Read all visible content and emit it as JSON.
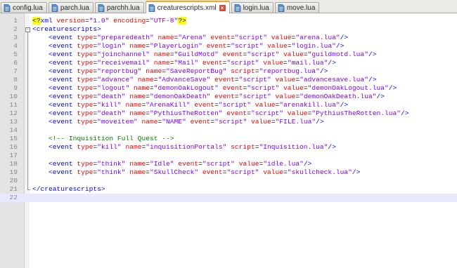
{
  "tabs": [
    {
      "label": "config.lua",
      "active": false
    },
    {
      "label": "parch.lua",
      "active": false
    },
    {
      "label": "parchh.lua",
      "active": false
    },
    {
      "label": "creaturescripts.xml",
      "active": true
    },
    {
      "label": "login.lua",
      "active": false
    },
    {
      "label": "move.lua",
      "active": false
    }
  ],
  "colors": {
    "tag": "#0000ff",
    "attribute": "#ff0000",
    "value": "#8000ff",
    "comment": "#008000",
    "line_number": "#878787",
    "current_line": "#e8e8ff",
    "active_tab_accent": "#f5a623"
  },
  "editor": {
    "current_line": 22,
    "lines": [
      {
        "n": "1",
        "tokens": [
          [
            "decl",
            "<?"
          ],
          [
            "tag",
            "xml "
          ],
          [
            "attr",
            "version"
          ],
          [
            "eq",
            "="
          ],
          [
            "val",
            "\"1.0\" "
          ],
          [
            "attr",
            "encoding"
          ],
          [
            "eq",
            "="
          ],
          [
            "val",
            "\"UTF-8\""
          ],
          [
            "decl",
            "?>"
          ]
        ]
      },
      {
        "n": "2",
        "tokens": [
          [
            "tag",
            "<creaturescripts>"
          ]
        ]
      },
      {
        "n": "3",
        "tokens": [
          [
            "tag",
            "    <event "
          ],
          [
            "attr",
            "type"
          ],
          [
            "eq",
            "="
          ],
          [
            "val",
            "\"preparedeath\" "
          ],
          [
            "attr",
            "name"
          ],
          [
            "eq",
            "="
          ],
          [
            "val",
            "\"Arena\" "
          ],
          [
            "attr",
            "event"
          ],
          [
            "eq",
            "="
          ],
          [
            "val",
            "\"script\" "
          ],
          [
            "attr",
            "value"
          ],
          [
            "eq",
            "="
          ],
          [
            "val",
            "\"arena.lua\""
          ],
          [
            "tag",
            "/>"
          ]
        ]
      },
      {
        "n": "4",
        "tokens": [
          [
            "tag",
            "    <event "
          ],
          [
            "attr",
            "type"
          ],
          [
            "eq",
            "="
          ],
          [
            "val",
            "\"login\" "
          ],
          [
            "attr",
            "name"
          ],
          [
            "eq",
            "="
          ],
          [
            "val",
            "\"PlayerLogin\" "
          ],
          [
            "attr",
            "event"
          ],
          [
            "eq",
            "="
          ],
          [
            "val",
            "\"script\" "
          ],
          [
            "attr",
            "value"
          ],
          [
            "eq",
            "="
          ],
          [
            "val",
            "\"login.lua\""
          ],
          [
            "tag",
            "/>"
          ]
        ]
      },
      {
        "n": "5",
        "tokens": [
          [
            "tag",
            "    <event "
          ],
          [
            "attr",
            "type"
          ],
          [
            "eq",
            "="
          ],
          [
            "val",
            "\"joinchannel\" "
          ],
          [
            "attr",
            "name"
          ],
          [
            "eq",
            "="
          ],
          [
            "val",
            "\"GuildMotd\" "
          ],
          [
            "attr",
            "event"
          ],
          [
            "eq",
            "="
          ],
          [
            "val",
            "\"script\" "
          ],
          [
            "attr",
            "value"
          ],
          [
            "eq",
            "="
          ],
          [
            "val",
            "\"guildmotd.lua\""
          ],
          [
            "tag",
            "/>"
          ]
        ]
      },
      {
        "n": "6",
        "tokens": [
          [
            "tag",
            "    <event "
          ],
          [
            "attr",
            "type"
          ],
          [
            "eq",
            "="
          ],
          [
            "val",
            "\"receivemail\" "
          ],
          [
            "attr",
            "name"
          ],
          [
            "eq",
            "="
          ],
          [
            "val",
            "\"Mail\" "
          ],
          [
            "attr",
            "event"
          ],
          [
            "eq",
            "="
          ],
          [
            "val",
            "\"script\" "
          ],
          [
            "attr",
            "value"
          ],
          [
            "eq",
            "="
          ],
          [
            "val",
            "\"mail.lua\""
          ],
          [
            "tag",
            "/>"
          ]
        ]
      },
      {
        "n": "7",
        "tokens": [
          [
            "tag",
            "    <event "
          ],
          [
            "attr",
            "type"
          ],
          [
            "eq",
            "="
          ],
          [
            "val",
            "\"reportbug\" "
          ],
          [
            "attr",
            "name"
          ],
          [
            "eq",
            "="
          ],
          [
            "val",
            "\"SaveReportBug\" "
          ],
          [
            "attr",
            "script"
          ],
          [
            "eq",
            "="
          ],
          [
            "val",
            "\"reportbug.lua\""
          ],
          [
            "tag",
            "/>"
          ]
        ]
      },
      {
        "n": "8",
        "tokens": [
          [
            "tag",
            "    <event "
          ],
          [
            "attr",
            "type"
          ],
          [
            "eq",
            "="
          ],
          [
            "val",
            "\"advance\" "
          ],
          [
            "attr",
            "name"
          ],
          [
            "eq",
            "="
          ],
          [
            "val",
            "\"AdvanceSave\" "
          ],
          [
            "attr",
            "event"
          ],
          [
            "eq",
            "="
          ],
          [
            "val",
            "\"script\" "
          ],
          [
            "attr",
            "value"
          ],
          [
            "eq",
            "="
          ],
          [
            "val",
            "\"advancesave.lua\""
          ],
          [
            "tag",
            "/>"
          ]
        ]
      },
      {
        "n": "9",
        "tokens": [
          [
            "tag",
            "    <event "
          ],
          [
            "attr",
            "type"
          ],
          [
            "eq",
            "="
          ],
          [
            "val",
            "\"logout\" "
          ],
          [
            "attr",
            "name"
          ],
          [
            "eq",
            "="
          ],
          [
            "val",
            "\"demonOakLogout\" "
          ],
          [
            "attr",
            "event"
          ],
          [
            "eq",
            "="
          ],
          [
            "val",
            "\"script\" "
          ],
          [
            "attr",
            "value"
          ],
          [
            "eq",
            "="
          ],
          [
            "val",
            "\"demonOakLogout.lua\""
          ],
          [
            "tag",
            "/>"
          ]
        ]
      },
      {
        "n": "10",
        "tokens": [
          [
            "tag",
            "    <event "
          ],
          [
            "attr",
            "type"
          ],
          [
            "eq",
            "="
          ],
          [
            "val",
            "\"death\" "
          ],
          [
            "attr",
            "name"
          ],
          [
            "eq",
            "="
          ],
          [
            "val",
            "\"demonOakDeath\" "
          ],
          [
            "attr",
            "event"
          ],
          [
            "eq",
            "="
          ],
          [
            "val",
            "\"script\" "
          ],
          [
            "attr",
            "value"
          ],
          [
            "eq",
            "="
          ],
          [
            "val",
            "\"demonOakDeath.lua\""
          ],
          [
            "tag",
            "/>"
          ]
        ]
      },
      {
        "n": "11",
        "tokens": [
          [
            "tag",
            "    <event "
          ],
          [
            "attr",
            "type"
          ],
          [
            "eq",
            "="
          ],
          [
            "val",
            "\"kill\" "
          ],
          [
            "attr",
            "name"
          ],
          [
            "eq",
            "="
          ],
          [
            "val",
            "\"ArenaKill\" "
          ],
          [
            "attr",
            "event"
          ],
          [
            "eq",
            "="
          ],
          [
            "val",
            "\"script\" "
          ],
          [
            "attr",
            "value"
          ],
          [
            "eq",
            "="
          ],
          [
            "val",
            "\"arenakill.lua\""
          ],
          [
            "tag",
            "/>"
          ]
        ]
      },
      {
        "n": "12",
        "tokens": [
          [
            "tag",
            "    <event "
          ],
          [
            "attr",
            "type"
          ],
          [
            "eq",
            "="
          ],
          [
            "val",
            "\"death\" "
          ],
          [
            "attr",
            "name"
          ],
          [
            "eq",
            "="
          ],
          [
            "val",
            "\"PythiusTheRotten\" "
          ],
          [
            "attr",
            "event"
          ],
          [
            "eq",
            "="
          ],
          [
            "val",
            "\"script\" "
          ],
          [
            "attr",
            "value"
          ],
          [
            "eq",
            "="
          ],
          [
            "val",
            "\"PythiusTheRotten.lua\""
          ],
          [
            "tag",
            "/>"
          ]
        ]
      },
      {
        "n": "13",
        "tokens": [
          [
            "tag",
            "    <event "
          ],
          [
            "attr",
            "type"
          ],
          [
            "eq",
            "="
          ],
          [
            "val",
            "\"moveitem\" "
          ],
          [
            "attr",
            "name"
          ],
          [
            "eq",
            "="
          ],
          [
            "val",
            "\"NAME\" "
          ],
          [
            "attr",
            "event"
          ],
          [
            "eq",
            "="
          ],
          [
            "val",
            "\"script\" "
          ],
          [
            "attr",
            "value"
          ],
          [
            "eq",
            "="
          ],
          [
            "val",
            "\"FILE.lua\""
          ],
          [
            "tag",
            "/>"
          ]
        ]
      },
      {
        "n": "14",
        "tokens": []
      },
      {
        "n": "15",
        "tokens": [
          [
            "comment",
            "    <!-- Inquisition Full Quest -->"
          ]
        ]
      },
      {
        "n": "16",
        "tokens": [
          [
            "tag",
            "    <event "
          ],
          [
            "attr",
            "type"
          ],
          [
            "eq",
            "="
          ],
          [
            "val",
            "\"kill\" "
          ],
          [
            "attr",
            "name"
          ],
          [
            "eq",
            "="
          ],
          [
            "val",
            "\"inquisitionPortals\" "
          ],
          [
            "attr",
            "script"
          ],
          [
            "eq",
            "="
          ],
          [
            "val",
            "\"Inquisition.lua\""
          ],
          [
            "tag",
            "/>"
          ]
        ]
      },
      {
        "n": "17",
        "tokens": []
      },
      {
        "n": "18",
        "tokens": [
          [
            "tag",
            "    <event "
          ],
          [
            "attr",
            "type"
          ],
          [
            "eq",
            "="
          ],
          [
            "val",
            "\"think\" "
          ],
          [
            "attr",
            "name"
          ],
          [
            "eq",
            "="
          ],
          [
            "val",
            "\"Idle\" "
          ],
          [
            "attr",
            "event"
          ],
          [
            "eq",
            "="
          ],
          [
            "val",
            "\"script\" "
          ],
          [
            "attr",
            "value"
          ],
          [
            "eq",
            "="
          ],
          [
            "val",
            "\"idle.lua\""
          ],
          [
            "tag",
            "/>"
          ]
        ]
      },
      {
        "n": "19",
        "tokens": [
          [
            "tag",
            "    <event "
          ],
          [
            "attr",
            "type"
          ],
          [
            "eq",
            "="
          ],
          [
            "val",
            "\"think\" "
          ],
          [
            "attr",
            "name"
          ],
          [
            "eq",
            "="
          ],
          [
            "val",
            "\"SkullCheck\" "
          ],
          [
            "attr",
            "event"
          ],
          [
            "eq",
            "="
          ],
          [
            "val",
            "\"script\" "
          ],
          [
            "attr",
            "value"
          ],
          [
            "eq",
            "="
          ],
          [
            "val",
            "\"skullcheck.lua\""
          ],
          [
            "tag",
            "/>"
          ]
        ]
      },
      {
        "n": "20",
        "tokens": []
      },
      {
        "n": "21",
        "tokens": [
          [
            "tag",
            "</creaturescripts>"
          ]
        ]
      },
      {
        "n": "22",
        "tokens": []
      }
    ]
  }
}
